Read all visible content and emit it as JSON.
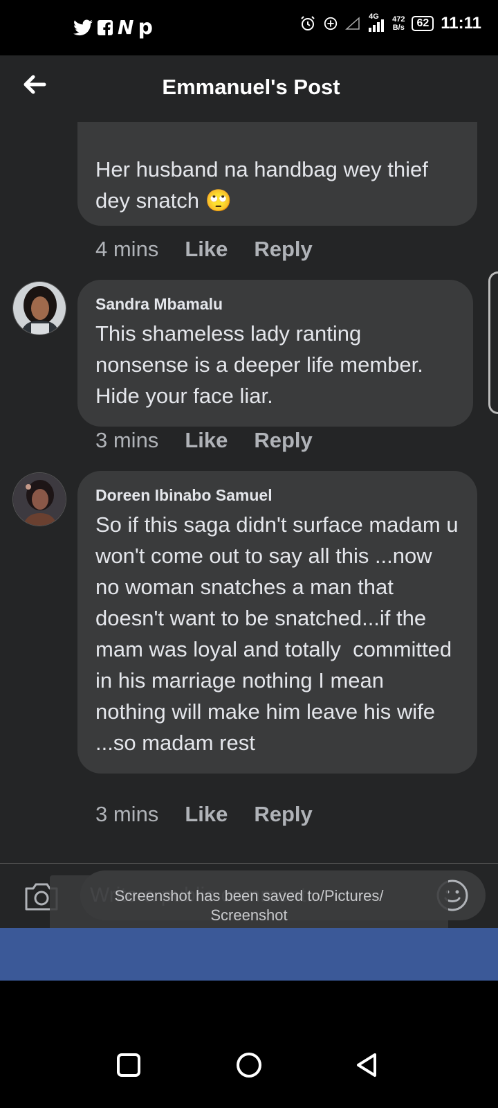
{
  "status_bar": {
    "apps": [
      "𝕪",
      "f",
      "N",
      "p"
    ],
    "net_speed_value": "472",
    "net_speed_unit": "B/s",
    "network": "4G",
    "battery": "62",
    "time": "11:11"
  },
  "header": {
    "title": "Emmanuel's Post"
  },
  "comments": [
    {
      "author": "",
      "text": "Her husband na handbag wey thief dey snatch 🙄",
      "time": "4 mins",
      "like": "Like",
      "reply": "Reply"
    },
    {
      "author": "Sandra Mbamalu",
      "text": "This shameless lady ranting nonsense is a deeper life member. Hide your face liar.",
      "time": "3 mins",
      "like": "Like",
      "reply": "Reply"
    },
    {
      "author": "Doreen Ibinabo Samuel",
      "text": "So if this saga didn't surface madam u won't come out to say all this ...now no woman snatches a man that doesn't want to be snatched...if the mam was loyal and totally  committed in his marriage nothing I mean nothing will make him leave his wife ...so madam rest",
      "time": "3 mins",
      "like": "Like",
      "reply": "Reply"
    }
  ],
  "composer": {
    "placeholder": "Write a public comment..."
  },
  "toast": {
    "line1": "Screenshot has been saved to/Pictures/",
    "line2": "Screenshot"
  },
  "colors": {
    "background": "#242526",
    "bubble": "#3a3b3c",
    "text": "#e4e6eb",
    "secondary_text": "#b0b3b8",
    "brand_blue": "#3b5998"
  }
}
